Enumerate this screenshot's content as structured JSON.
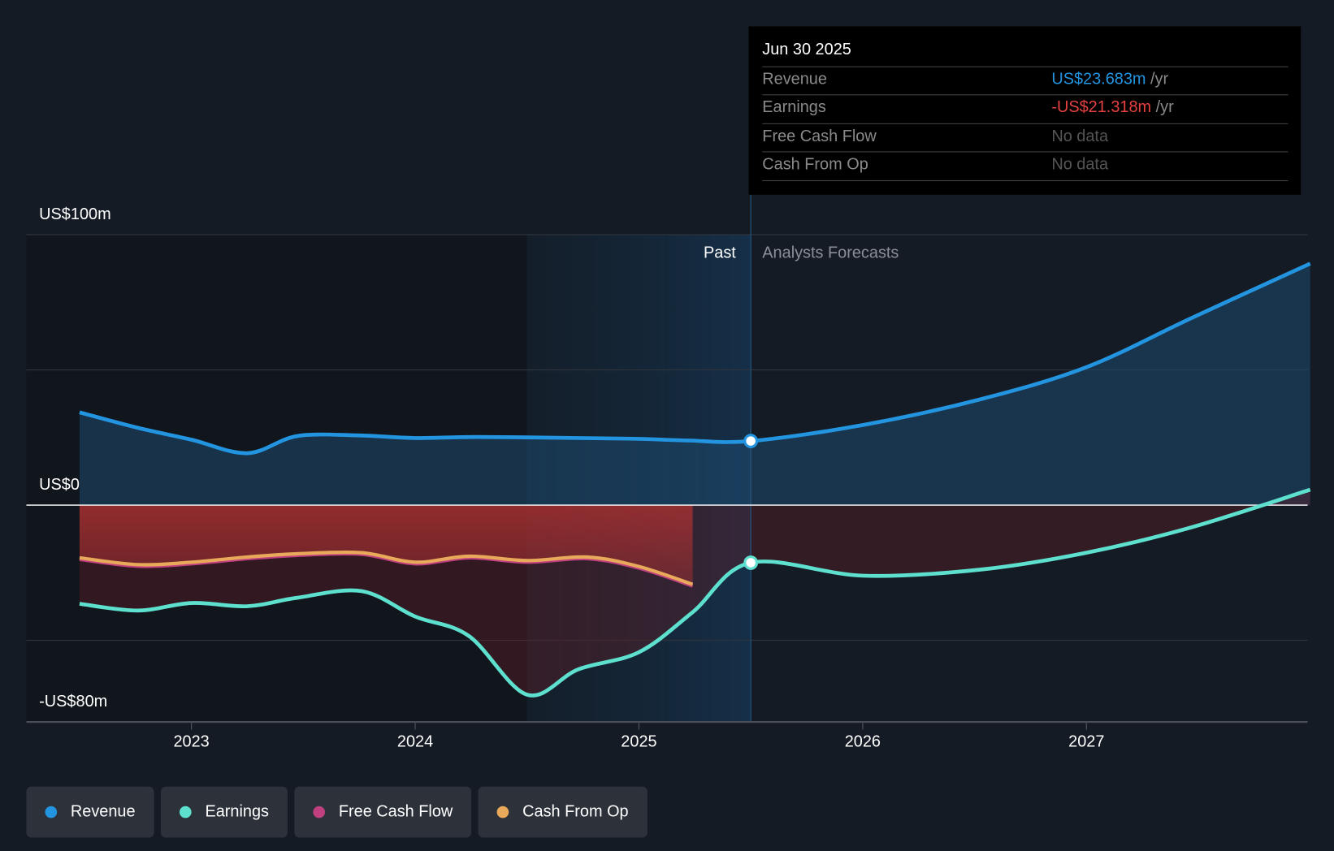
{
  "tooltip": {
    "date": "Jun 30 2025",
    "rows": [
      {
        "label": "Revenue",
        "value": "US$23.683m",
        "unit": "/yr",
        "color": "#2394df"
      },
      {
        "label": "Earnings",
        "value": "-US$21.318m",
        "unit": "/yr",
        "color": "#e64141"
      },
      {
        "label": "Free Cash Flow",
        "value": "No data",
        "unit": ""
      },
      {
        "label": "Cash From Op",
        "value": "No data",
        "unit": ""
      }
    ]
  },
  "chart_data": {
    "type": "line",
    "ylim": [
      -80,
      100
    ],
    "xlim": [
      2022.3,
      2028
    ],
    "y_ticks": [
      {
        "v": 100,
        "label": "US$100m"
      },
      {
        "v": 0,
        "label": "US$0"
      },
      {
        "v": -80,
        "label": "-US$80m"
      }
    ],
    "x_ticks": [
      {
        "v": 2023,
        "label": "2023"
      },
      {
        "v": 2024,
        "label": "2024"
      },
      {
        "v": 2025,
        "label": "2025"
      },
      {
        "v": 2026,
        "label": "2026"
      },
      {
        "v": 2027,
        "label": "2027"
      }
    ],
    "past_label": "Past",
    "forecast_label": "Analysts Forecasts",
    "past_end": 2025.5,
    "highlight_start": 2024.5,
    "series": [
      {
        "name": "Revenue",
        "color": "#2394df",
        "x": [
          2022.5,
          2022.76,
          2023,
          2023.25,
          2023.47,
          2023.74,
          2024,
          2024.27,
          2024.73,
          2025,
          2025.22,
          2025.5,
          2026,
          2026.52,
          2027,
          2027.47,
          2028
        ],
        "values": [
          34.3,
          28.6,
          24.2,
          19.2,
          25.5,
          25.8,
          24.8,
          25.2,
          24.8,
          24.5,
          23.9,
          23.7,
          29.6,
          39.0,
          51.0,
          69.2,
          89.3
        ]
      },
      {
        "name": "Earnings",
        "color": "#5ee0cf",
        "x": [
          2022.5,
          2022.76,
          2023,
          2023.25,
          2023.47,
          2023.76,
          2024,
          2024.24,
          2024.5,
          2024.73,
          2025,
          2025.24,
          2025.5,
          2026,
          2026.52,
          2027,
          2027.47,
          2028
        ],
        "values": [
          -36.5,
          -39,
          -36.2,
          -37.4,
          -34.3,
          -31.8,
          -41.2,
          -48.4,
          -70.1,
          -60.7,
          -54.4,
          -39.6,
          -21.3,
          -26.1,
          -23.9,
          -17.6,
          -8.2,
          5.7
        ]
      },
      {
        "name": "Free Cash Flow",
        "color": "#c0407f",
        "x": [
          2022.5,
          2022.76,
          2023,
          2023.25,
          2023.47,
          2023.76,
          2024,
          2024.24,
          2024.5,
          2024.77,
          2025,
          2025.24
        ],
        "values": [
          -20.1,
          -22.6,
          -21.7,
          -19.8,
          -18.6,
          -18.2,
          -21.7,
          -19.5,
          -21.1,
          -19.8,
          -23.3,
          -29.9
        ]
      },
      {
        "name": "Cash From Op",
        "color": "#e8a95a",
        "x": [
          2022.5,
          2022.76,
          2023,
          2023.25,
          2023.47,
          2023.76,
          2024,
          2024.24,
          2024.5,
          2024.77,
          2025,
          2025.24
        ],
        "values": [
          -19.5,
          -22,
          -21.1,
          -19.2,
          -18,
          -17.6,
          -21.1,
          -18.9,
          -20.5,
          -19.2,
          -22.7,
          -29.3
        ]
      }
    ]
  }
}
